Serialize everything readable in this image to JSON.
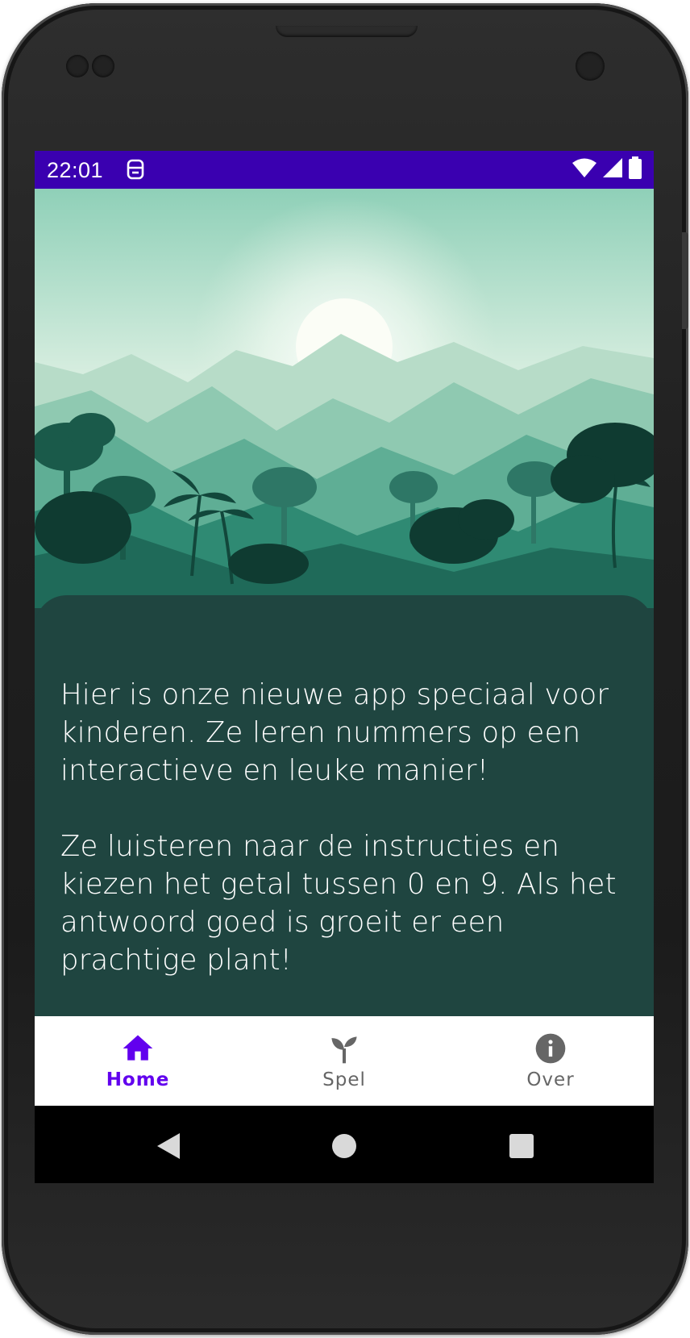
{
  "status_bar": {
    "time": "22:01",
    "notification_icon": "sim-card-icon",
    "icons": [
      "wifi-icon",
      "cellular-signal-icon",
      "battery-icon"
    ],
    "background_color": "#3a00b0"
  },
  "hero": {
    "image": "jungle-landscape-illustration"
  },
  "content": {
    "paragraph_1": "Hier is onze nieuwe app speciaal voor kinderen. Ze leren nummers op een interactieve en leuke manier!",
    "paragraph_2": "Ze luisteren naar de instructies en kiezen het getal tussen 0 en 9. Als het antwoord goed is groeit er een prachtige plant!",
    "background_color": "#1f4540"
  },
  "bottom_nav": {
    "items": [
      {
        "label": "Home",
        "icon": "home-icon",
        "active": true
      },
      {
        "label": "Spel",
        "icon": "sprout-icon",
        "active": false
      },
      {
        "label": "Over",
        "icon": "info-icon",
        "active": false
      }
    ],
    "active_color": "#6200ee",
    "inactive_color": "#666666"
  },
  "system_nav": {
    "buttons": [
      "back-icon",
      "home-circle-icon",
      "recents-icon"
    ]
  }
}
